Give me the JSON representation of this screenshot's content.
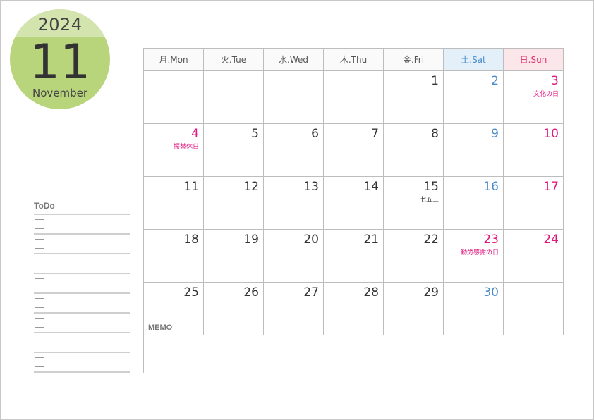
{
  "header": {
    "year": "2024",
    "month_number": "11",
    "month_name": "November"
  },
  "colors": {
    "badge_main": "#b8d57c",
    "badge_top": "#d4e4ae",
    "saturday": "#4a8cc9",
    "sunday_holiday": "#e0177f",
    "saturday_header_bg": "#e3eff9",
    "sunday_header_bg": "#fbe6ea"
  },
  "todo": {
    "title": "ToDo",
    "items": [
      "",
      "",
      "",
      "",
      "",
      "",
      "",
      ""
    ]
  },
  "calendar": {
    "weekdays": [
      "月.Mon",
      "火.Tue",
      "水.Wed",
      "木.Thu",
      "金.Fri",
      "土.Sat",
      "日.Sun"
    ],
    "weeks": [
      [
        {
          "d": ""
        },
        {
          "d": ""
        },
        {
          "d": ""
        },
        {
          "d": ""
        },
        {
          "d": "1"
        },
        {
          "d": "2",
          "t": "sat"
        },
        {
          "d": "3",
          "t": "sun",
          "note": "文化の日"
        }
      ],
      [
        {
          "d": "4",
          "t": "sun",
          "note": "振替休日"
        },
        {
          "d": "5"
        },
        {
          "d": "6"
        },
        {
          "d": "7"
        },
        {
          "d": "8"
        },
        {
          "d": "9",
          "t": "sat"
        },
        {
          "d": "10",
          "t": "sun"
        }
      ],
      [
        {
          "d": "11"
        },
        {
          "d": "12"
        },
        {
          "d": "13"
        },
        {
          "d": "14"
        },
        {
          "d": "15",
          "note": "七五三",
          "nt": "normal"
        },
        {
          "d": "16",
          "t": "sat"
        },
        {
          "d": "17",
          "t": "sun"
        }
      ],
      [
        {
          "d": "18"
        },
        {
          "d": "19"
        },
        {
          "d": "20"
        },
        {
          "d": "21"
        },
        {
          "d": "22"
        },
        {
          "d": "23",
          "t": "sun",
          "note": "勤労感謝の日"
        },
        {
          "d": "24",
          "t": "sun"
        }
      ],
      [
        {
          "d": "25"
        },
        {
          "d": "26"
        },
        {
          "d": "27"
        },
        {
          "d": "28"
        },
        {
          "d": "29"
        },
        {
          "d": "30",
          "t": "sat"
        },
        {
          "d": ""
        }
      ]
    ]
  },
  "memo": {
    "label": "MEMO"
  }
}
